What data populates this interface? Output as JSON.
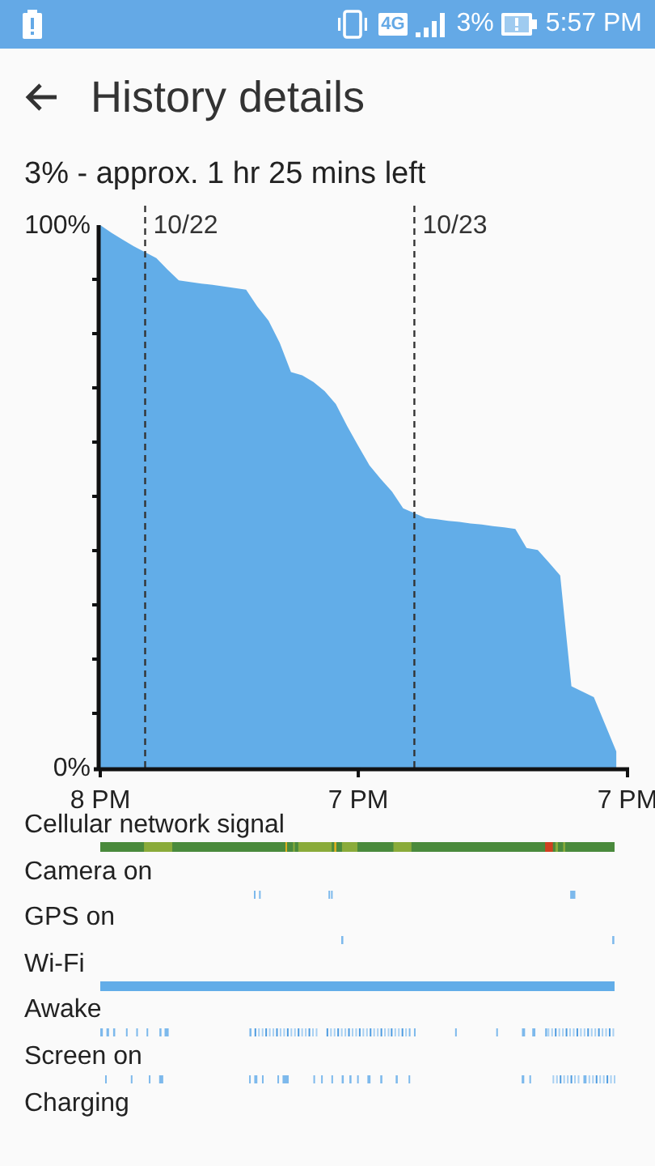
{
  "status_bar": {
    "network": "4G",
    "battery_percent": "3%",
    "time": "5:57 PM"
  },
  "header": {
    "title": "History details"
  },
  "summary": "3% - approx. 1 hr 25 mins left",
  "chart": {
    "chart_data": {
      "type": "area",
      "categories": [
        "8 PM",
        null,
        null,
        null,
        null,
        null,
        null,
        null,
        null,
        null,
        null,
        null,
        null,
        null,
        null,
        null,
        null,
        null,
        null,
        null,
        null,
        null,
        null,
        "7 PM",
        null,
        null,
        null,
        null,
        null,
        null,
        null,
        null,
        null,
        null,
        null,
        null,
        null,
        null,
        null,
        null,
        null,
        null,
        null,
        null,
        null,
        null,
        null,
        "7 PM"
      ],
      "series": [
        {
          "color": "#62ade8",
          "values": [
            100,
            98.6,
            97.3,
            96.1,
            95,
            93.9,
            91.8,
            89.8,
            89.5,
            89.2,
            89.0,
            88.7,
            88.4,
            88.1,
            85.0,
            82.4,
            78.3,
            72.9,
            72.3,
            71.1,
            69.4,
            67.0,
            63.0,
            59.3,
            55.7,
            53.2,
            50.9,
            47.8,
            46.9,
            46,
            45.8,
            45.5,
            45.3,
            45.0,
            44.8,
            44.5,
            44.3,
            44.0,
            40.5,
            40.1,
            37.8,
            35.4,
            15,
            14,
            13,
            8,
            3,
            null
          ]
        }
      ],
      "ylim": [
        0,
        100
      ],
      "yticks": [
        {
          "value": 0,
          "label": "0%"
        },
        {
          "value": 100,
          "label": "100%"
        }
      ],
      "annotations": [
        "10/22",
        "10/23"
      ]
    }
  },
  "tracks": [
    {
      "label": "Cellular network signal",
      "kind": "signal"
    },
    {
      "label": "Camera on",
      "kind": "camera"
    },
    {
      "label": "GPS on",
      "kind": "gps"
    },
    {
      "label": "Wi-Fi",
      "kind": "full"
    },
    {
      "label": "Awake",
      "kind": "awake"
    },
    {
      "label": "Screen on",
      "kind": "screen"
    },
    {
      "label": "Charging",
      "kind": "none"
    }
  ]
}
